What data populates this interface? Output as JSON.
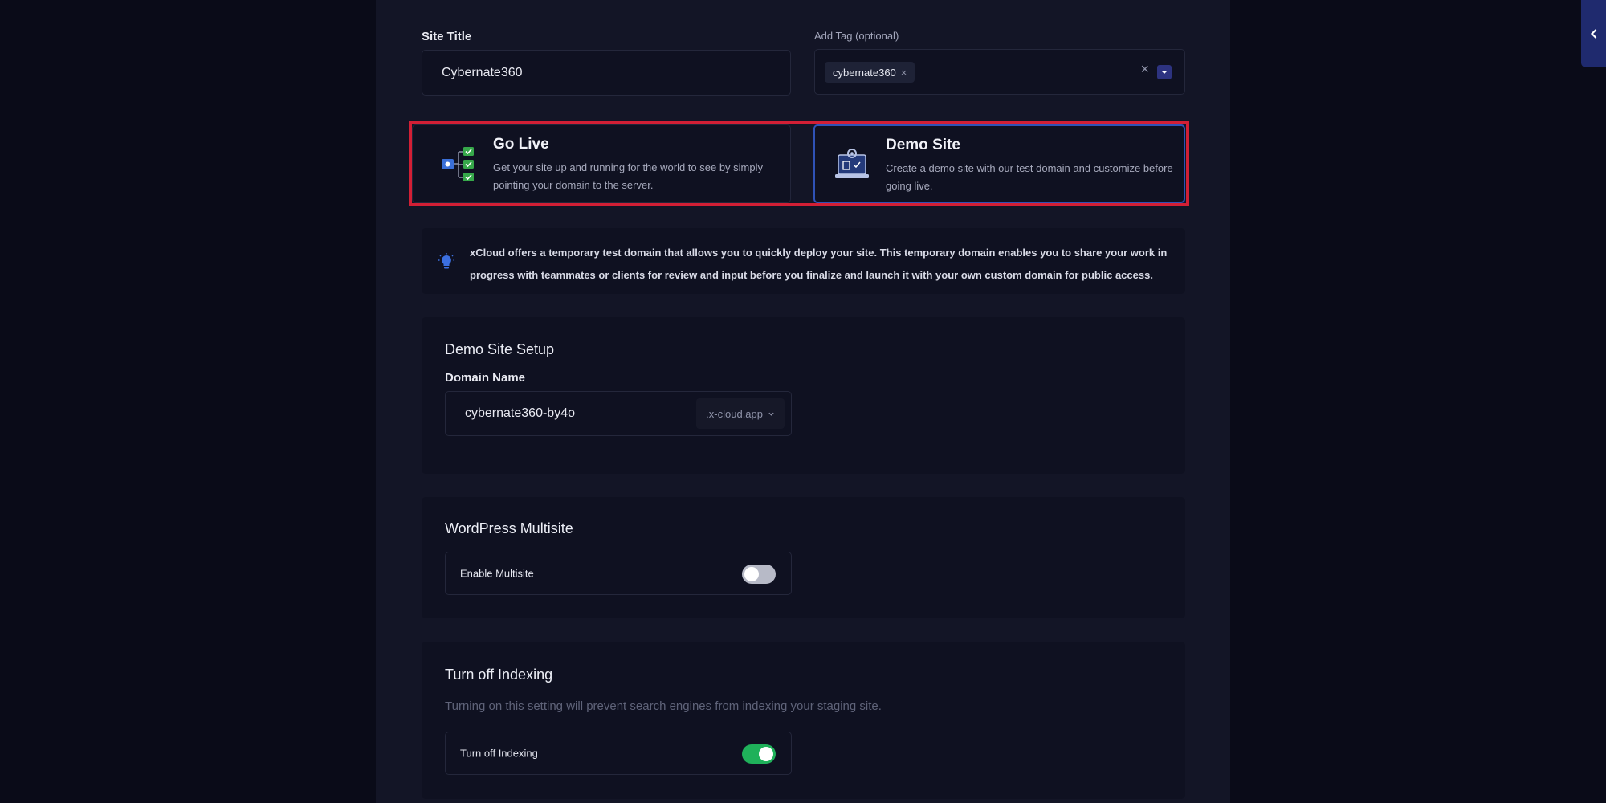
{
  "form": {
    "site_title_label": "Site Title",
    "site_title_value": "Cybernate360",
    "tag_label": "Add Tag (optional)",
    "tag_chip": "cybernate360",
    "tag_chip_remove": "×",
    "tag_clear": "×"
  },
  "options": {
    "go_live": {
      "title": "Go Live",
      "description": "Get your site up and running for the world to see by simply pointing your domain to the server."
    },
    "demo_site": {
      "title": "Demo Site",
      "description": "Create a demo site with our test domain and customize before going live."
    }
  },
  "info": {
    "text": "xCloud offers a temporary test domain that allows you to quickly deploy your site. This temporary domain enables you to share your work in progress with teammates or clients for review and input before you finalize and launch it with your own custom domain for public access."
  },
  "demo_setup": {
    "title": "Demo Site Setup",
    "domain_label": "Domain Name",
    "domain_value": "cybernate360-by4o",
    "domain_suffix": ".x-cloud.app"
  },
  "multisite": {
    "title": "WordPress Multisite",
    "toggle_label": "Enable Multisite",
    "enabled": false
  },
  "indexing": {
    "title": "Turn off Indexing",
    "description": "Turning on this setting will prevent search engines from indexing your staging site.",
    "toggle_label": "Turn off Indexing",
    "enabled": true
  },
  "colors": {
    "background": "#0a0b18",
    "panel": "#131526",
    "highlight": "#d21f35",
    "selected_border": "#2f52b6",
    "toggle_on": "#1fb15a"
  },
  "icons": {
    "go_live": "checklist-server-icon",
    "demo_site": "laptop-gear-icon",
    "info": "lightbulb-icon",
    "collapse": "chevron-left-icon"
  }
}
